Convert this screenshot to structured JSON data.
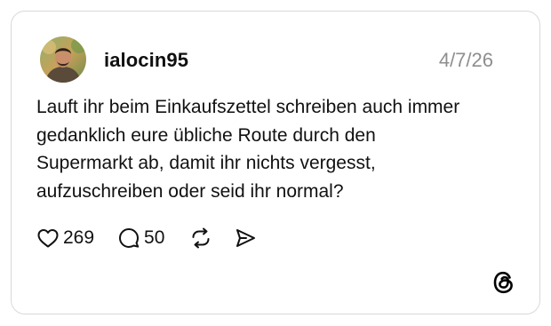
{
  "post": {
    "username": "ialocin95",
    "date": "4/7/26",
    "text": "Lauft ihr beim Einkaufszettel schreiben auch immer\ngedanklich eure übliche Route durch den\nSupermarkt ab, damit ihr nichts vergesst,\naufzuschreiben oder seid ihr normal?",
    "likes": "269",
    "comments": "50"
  },
  "icons": {
    "like": "heart-icon",
    "comment": "comment-bubble-icon",
    "repost": "repost-icon",
    "share": "send-icon",
    "brand": "threads-logo-icon"
  },
  "colors": {
    "date": "#8e8e8e",
    "border": "#d9d9d9",
    "text": "#111111"
  }
}
